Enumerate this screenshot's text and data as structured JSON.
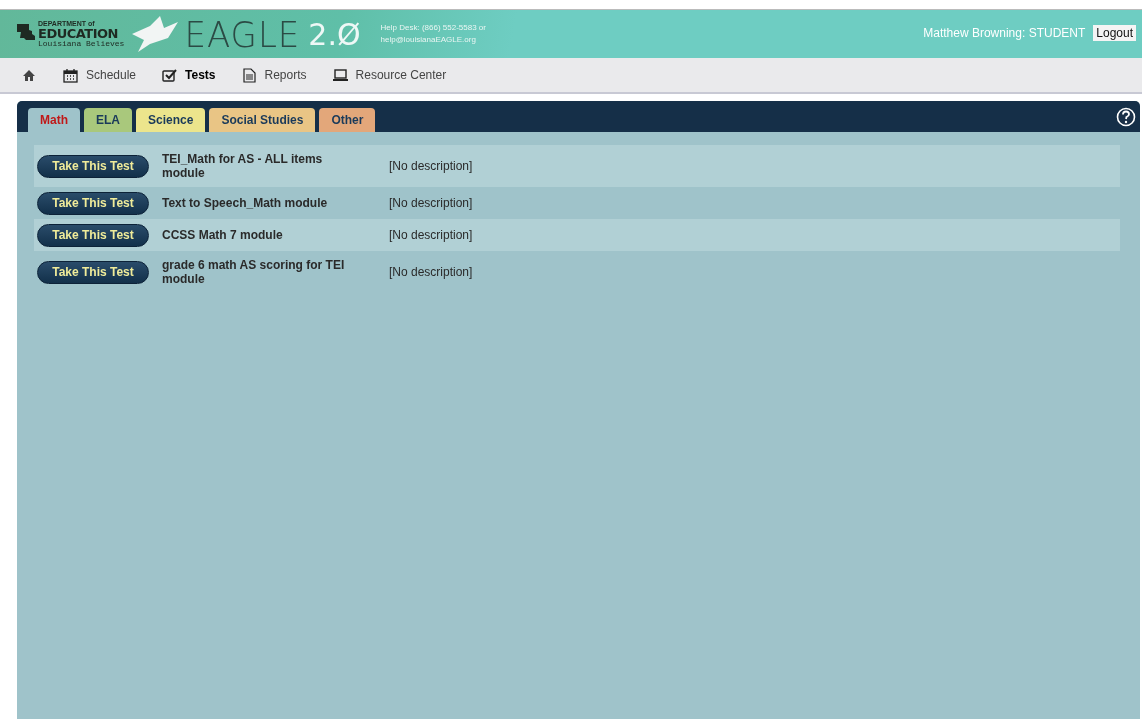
{
  "header": {
    "logo": {
      "top": "DEPARTMENT of",
      "main": "EDUCATION",
      "tagline": "Louisiana Believes"
    },
    "brand": {
      "name": "EAGLE",
      "version": "2.Ø"
    },
    "help": [
      "Help Desk: (866) 552-5583 or",
      "help@louisianaEAGLE.org"
    ],
    "user": "Matthew Browning: STUDENT",
    "logout": "Logout"
  },
  "nav": [
    {
      "kind": "home",
      "selected": false
    },
    {
      "kind": "calendar",
      "label": "Schedule",
      "selected": false
    },
    {
      "kind": "check",
      "label": "Tests",
      "selected": true
    },
    {
      "kind": "document",
      "label": "Reports",
      "selected": false
    },
    {
      "kind": "laptop",
      "label": "Resource Center",
      "selected": false
    }
  ],
  "tabs": [
    {
      "label": "Math",
      "selected": true,
      "color": "#9fc3ca"
    },
    {
      "label": "ELA",
      "selected": false,
      "color": "#a9c87c"
    },
    {
      "label": "Science",
      "selected": false,
      "color": "#ece58c"
    },
    {
      "label": "Social Studies",
      "selected": false,
      "color": "#e9c585"
    },
    {
      "label": "Other",
      "selected": false,
      "color": "#e3a77a"
    }
  ],
  "tests": [
    {
      "button": "Take This Test",
      "name": "TEI_Math for AS - ALL items module",
      "description": "[No description]"
    },
    {
      "button": "Take This Test",
      "name": "Text to Speech_Math module",
      "description": "[No description]"
    },
    {
      "button": "Take This Test",
      "name": "CCSS Math 7 module",
      "description": "[No description]"
    },
    {
      "button": "Take This Test",
      "name": "grade 6 math AS scoring for TEI module",
      "description": "[No description]"
    }
  ]
}
